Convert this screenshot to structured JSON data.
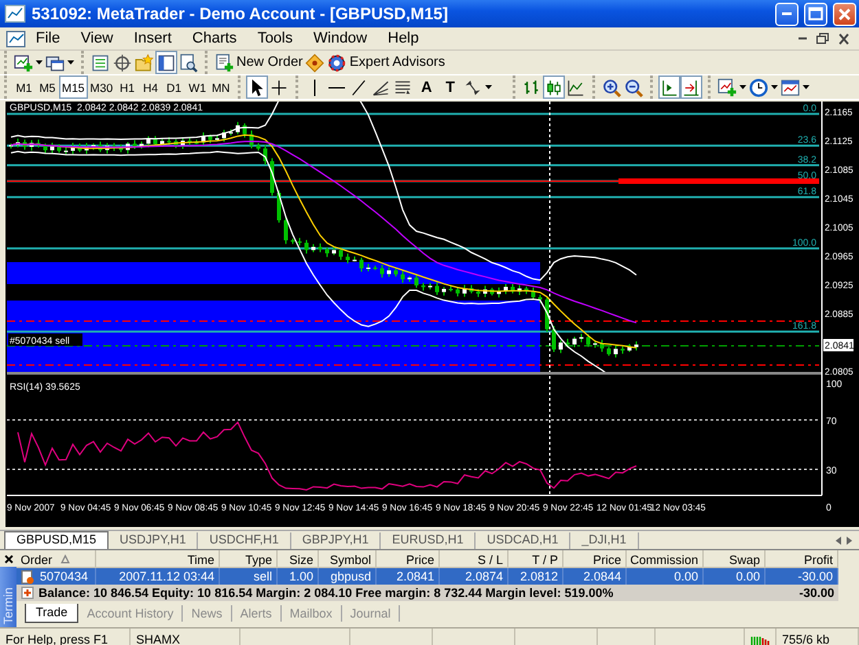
{
  "window": {
    "title": "531092: MetaTrader - Demo Account - [GBPUSD,M15]"
  },
  "menu": [
    "File",
    "View",
    "Insert",
    "Charts",
    "Tools",
    "Window",
    "Help"
  ],
  "standard_toolbar": [
    [
      {
        "kind": "new-chart",
        "dropdown": true,
        "selected": false
      },
      {
        "kind": "profiles",
        "dropdown": true,
        "selected": false
      }
    ],
    [
      {
        "kind": "market-watch",
        "selected": false
      },
      {
        "kind": "data-window",
        "selected": false
      },
      {
        "kind": "navigator",
        "selected": false
      },
      {
        "kind": "terminal",
        "selected": true
      },
      {
        "kind": "tester",
        "selected": false
      }
    ],
    [
      {
        "kind": "new-order",
        "label": "New Order",
        "selected": false
      },
      {
        "kind": "meta-editor",
        "selected": false
      },
      {
        "kind": "experts",
        "label": "Expert Advisors",
        "selected": false
      }
    ]
  ],
  "timeframes": [
    {
      "label": "M1",
      "selected": false
    },
    {
      "label": "M5",
      "selected": false
    },
    {
      "label": "M15",
      "selected": true
    },
    {
      "label": "M30",
      "selected": false
    },
    {
      "label": "H1",
      "selected": false
    },
    {
      "label": "H4",
      "selected": false
    },
    {
      "label": "D1",
      "selected": false
    },
    {
      "label": "W1",
      "selected": false
    },
    {
      "label": "MN",
      "selected": false
    }
  ],
  "line_studies_toolbar": [
    [
      {
        "kind": "cursor",
        "selected": true
      },
      {
        "kind": "crosshair",
        "selected": false
      }
    ],
    [
      {
        "kind": "vline",
        "selected": false
      },
      {
        "kind": "hline",
        "selected": false
      },
      {
        "kind": "trendline",
        "selected": false
      },
      {
        "kind": "fibonacci",
        "selected": false
      },
      {
        "kind": "channel",
        "selected": false
      },
      {
        "kind": "text",
        "label": "A",
        "selected": false
      },
      {
        "kind": "text-label",
        "label": "T",
        "selected": false
      },
      {
        "kind": "arrows",
        "dropdown": true,
        "selected": false
      }
    ]
  ],
  "charts_toolbar": [
    [
      {
        "kind": "bar-chart",
        "selected": false
      },
      {
        "kind": "candlesticks",
        "selected": true
      },
      {
        "kind": "line-chart",
        "selected": false
      }
    ],
    [
      {
        "kind": "zoom-in",
        "selected": false
      },
      {
        "kind": "zoom-out",
        "selected": false
      }
    ],
    [
      {
        "kind": "autoscroll",
        "selected": true
      },
      {
        "kind": "chart-shift",
        "selected": true
      }
    ],
    [
      {
        "kind": "indicators",
        "dropdown": true,
        "selected": false
      },
      {
        "kind": "periods",
        "dropdown": true,
        "selected": false
      },
      {
        "kind": "templates",
        "dropdown": true,
        "selected": false
      }
    ]
  ],
  "chart": {
    "header": "GBPUSD,M15  2.0842 2.0842 2.0839 2.0841",
    "fib_levels": [
      "0.0",
      "23.6",
      "38.2",
      "50.0",
      "61.8",
      "100.0",
      "161.8"
    ],
    "order_label": "#5070434 sell",
    "price_ticks": [
      "2.1165",
      "2.1125",
      "2.1085",
      "2.1045",
      "2.1005",
      "2.0965",
      "2.0925",
      "2.0885",
      "2.0805"
    ],
    "current_price": "2.0841",
    "indicator": "RSI(14) 39.5625",
    "indicator_ticks": [
      "100",
      "70",
      "30",
      "0"
    ],
    "time_ticks": [
      "9 Nov 2007",
      "9 Nov 04:45",
      "9 Nov 06:45",
      "9 Nov 08:45",
      "9 Nov 10:45",
      "9 Nov 12:45",
      "9 Nov 14:45",
      "9 Nov 16:45",
      "9 Nov 18:45",
      "9 Nov 20:45",
      "9 Nov 22:45",
      "12 Nov 01:45",
      "12 Nov 03:45"
    ]
  },
  "chart_tabs": [
    {
      "label": "GBPUSD,M15",
      "selected": true
    },
    {
      "label": "USDJPY,H1",
      "selected": false
    },
    {
      "label": "USDCHF,H1",
      "selected": false
    },
    {
      "label": "GBPJPY,H1",
      "selected": false
    },
    {
      "label": "EURUSD,H1",
      "selected": false
    },
    {
      "label": "USDCAD,H1",
      "selected": false
    },
    {
      "label": "_DJI,H1",
      "selected": false
    }
  ],
  "terminal": {
    "title": "Termin",
    "columns": [
      "Order",
      "Time",
      "Type",
      "Size",
      "Symbol",
      "Price",
      "S / L",
      "T / P",
      "Price",
      "Commission",
      "Swap",
      "Profit"
    ],
    "rows": [
      {
        "selected": true,
        "cells": [
          "5070434",
          "2007.11.12 03:44",
          "sell",
          "1.00",
          "gbpusd",
          "2.0841",
          "2.0874",
          "2.0812",
          "2.0844",
          "0.00",
          "0.00",
          "-30.00"
        ]
      }
    ],
    "summary": "Balance: 10 846.54  Equity: 10 816.54  Margin: 2 084.10  Free margin: 8 732.44  Margin level: 519.00%",
    "summary_profit": "-30.00",
    "tabs": [
      {
        "label": "Trade",
        "selected": true
      },
      {
        "label": "Account History",
        "selected": false
      },
      {
        "label": "News",
        "selected": false
      },
      {
        "label": "Alerts",
        "selected": false
      },
      {
        "label": "Mailbox",
        "selected": false
      },
      {
        "label": "Journal",
        "selected": false
      }
    ]
  },
  "status_bar": {
    "help": "For Help, press F1",
    "profile": "SHAMX",
    "traffic": "755/6 kb"
  }
}
